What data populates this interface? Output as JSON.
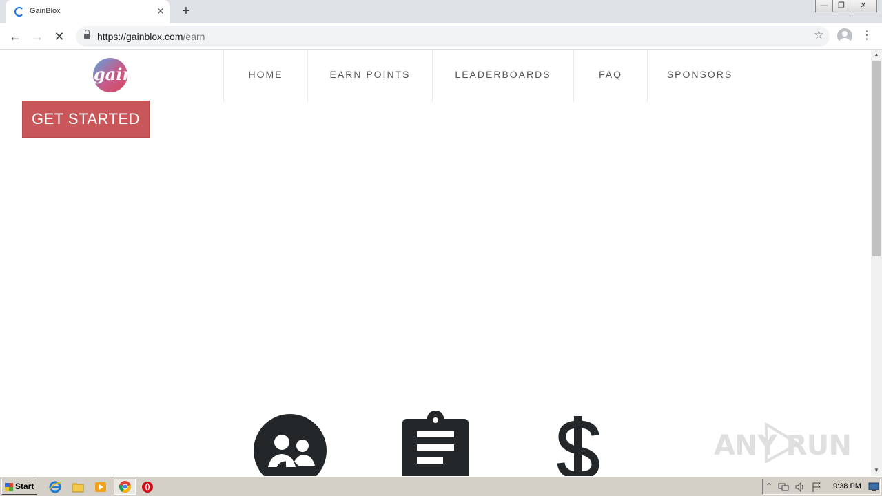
{
  "browser": {
    "tab_title": "GainBlox",
    "tab_close": "✕",
    "new_tab": "+",
    "url_host": "https://gainblox.com",
    "url_path": "/earn",
    "back": "←",
    "forward": "→",
    "stop": "✕",
    "star": "☆",
    "menu": "⋮",
    "win_min": "—",
    "win_restore": "❐",
    "win_close": "✕"
  },
  "site": {
    "logo_text": "gainblox",
    "nav": [
      "HOME",
      "EARN POINTS",
      "LEADERBOARDS",
      "FAQ",
      "SPONSORS"
    ],
    "cta_label": "GET STARTED"
  },
  "features": {
    "icons": [
      "users-circle-icon",
      "clipboard-icon",
      "dollar-icon"
    ]
  },
  "watermark": {
    "text": "ANY RUN"
  },
  "scrollbar": {
    "up": "▲",
    "down": "▼"
  },
  "taskbar": {
    "start_label": "Start",
    "clock": "9:38 PM",
    "tray_arrow": "⌃"
  },
  "colors": {
    "cta": "#c95658",
    "icon": "#23272a",
    "chrome_accent": "#1a73e8"
  }
}
